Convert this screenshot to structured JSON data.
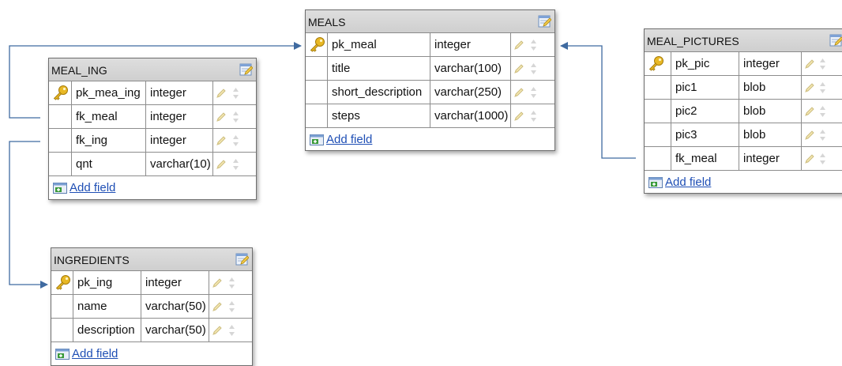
{
  "tables": {
    "meals": {
      "name": "MEALS",
      "rows": [
        {
          "field": "pk_meal",
          "type": "integer",
          "primary_key": true
        },
        {
          "field": "title",
          "type": "varchar(100)",
          "primary_key": false
        },
        {
          "field": "short_description",
          "type": "varchar(250)",
          "primary_key": false
        },
        {
          "field": "steps",
          "type": "varchar(1000)",
          "primary_key": false
        }
      ],
      "add_field_label": "Add field"
    },
    "meal_ing": {
      "name": "MEAL_ING",
      "rows": [
        {
          "field": "pk_mea_ing",
          "type": "integer",
          "primary_key": true
        },
        {
          "field": "fk_meal",
          "type": "integer",
          "primary_key": false
        },
        {
          "field": "fk_ing",
          "type": "integer",
          "primary_key": false
        },
        {
          "field": "qnt",
          "type": "varchar(10)",
          "primary_key": false
        }
      ],
      "add_field_label": "Add field"
    },
    "meal_pictures": {
      "name": "MEAL_PICTURES",
      "rows": [
        {
          "field": "pk_pic",
          "type": "integer",
          "primary_key": true
        },
        {
          "field": "pic1",
          "type": "blob",
          "primary_key": false
        },
        {
          "field": "pic2",
          "type": "blob",
          "primary_key": false
        },
        {
          "field": "pic3",
          "type": "blob",
          "primary_key": false
        },
        {
          "field": "fk_meal",
          "type": "integer",
          "primary_key": false
        }
      ],
      "add_field_label": "Add field"
    },
    "ingredients": {
      "name": "INGREDIENTS",
      "rows": [
        {
          "field": "pk_ing",
          "type": "integer",
          "primary_key": true
        },
        {
          "field": "name",
          "type": "varchar(50)",
          "primary_key": false
        },
        {
          "field": "description",
          "type": "varchar(50)",
          "primary_key": false
        }
      ],
      "add_field_label": "Add field"
    }
  },
  "relations": [
    {
      "from": "meal_ing.fk_meal",
      "to": "meals.pk_meal"
    },
    {
      "from": "meal_pictures.fk_meal",
      "to": "meals.pk_meal"
    },
    {
      "from": "meal_ing.fk_ing",
      "to": "ingredients.pk_ing"
    }
  ],
  "colors": {
    "connector": "#3f6aa0",
    "header_bg": "#d7d7d7",
    "link": "#1f4fb5"
  },
  "icons": [
    "key-icon",
    "pencil-icon",
    "sort-arrows-icon",
    "edit-table-icon",
    "add-field-icon"
  ]
}
